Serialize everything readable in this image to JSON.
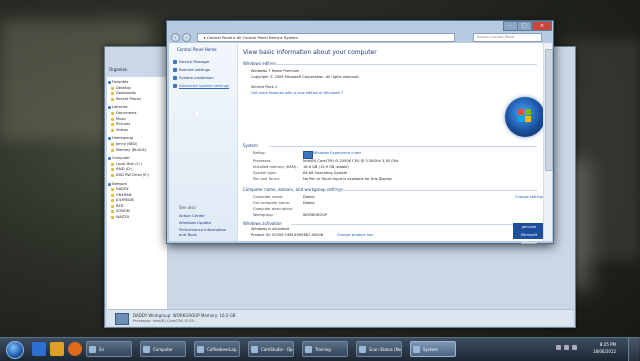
{
  "explorer": {
    "toolbar": "Organize",
    "nav": [
      {
        "label": "Favorites",
        "head": true
      },
      {
        "label": "Desktop"
      },
      {
        "label": "Downloads"
      },
      {
        "label": "Recent Places"
      },
      {
        "label": "Libraries",
        "head": true
      },
      {
        "label": "Documents"
      },
      {
        "label": "Music"
      },
      {
        "label": "Pictures"
      },
      {
        "label": "Videos"
      },
      {
        "label": "Homegroup",
        "head": true
      },
      {
        "label": "Jenny (BED)"
      },
      {
        "label": "Mommy (BLACK)"
      },
      {
        "label": "Computer",
        "head": true
      },
      {
        "label": "Local Disk (C:)"
      },
      {
        "label": "RAID (D:)"
      },
      {
        "label": "DVD RW Drive (E:)"
      },
      {
        "label": "Network",
        "head": true
      },
      {
        "label": "DADDY"
      },
      {
        "label": "GRAHAN"
      },
      {
        "label": "JULYREDIE"
      },
      {
        "label": "RED"
      },
      {
        "label": "SONOM"
      },
      {
        "label": "WAZZA"
      }
    ],
    "status_name": "DADDY  Workgroup: WORKGROUP   Memory: 16.0 GB",
    "status_cpu": "Processor: Intel(R) Core(TM) i5-25..."
  },
  "system": {
    "address": "▸ Control Panel ▸ All Control Panel Items ▸ System",
    "search_placeholder": "Search Control Panel",
    "left": {
      "home": "Control Panel Home",
      "links": [
        "Device Manager",
        "Remote settings",
        "System protection",
        "Advanced system settings"
      ],
      "see_also": "See also",
      "see_links": [
        "Action Center",
        "Windows Update",
        "Performance Information and Tools"
      ]
    },
    "main": {
      "title": "View basic information about your computer",
      "edition_header": "Windows edition",
      "edition": "Windows 7 Home Premium",
      "copyright": "Copyright © 2009 Microsoft Corporation. All rights reserved.",
      "service_pack": "Service Pack 1",
      "upgrade_link": "Get more features with a new edition of Windows 7",
      "system_header": "System",
      "rows": [
        {
          "label": "Rating:",
          "value": "Windows Experience Index"
        },
        {
          "label": "Processor:",
          "value": "Intel(R) Core(TM) i5-2500K CPU @ 3.30GHz   3.30 GHz"
        },
        {
          "label": "Installed memory (RAM):",
          "value": "16.0 GB (15.9 GB usable)"
        },
        {
          "label": "System type:",
          "value": "64-bit Operating System"
        },
        {
          "label": "Pen and Touch:",
          "value": "No Pen or Touch Input is available for this Display"
        }
      ],
      "name_header": "Computer name, domain, and workgroup settings",
      "name_rows": [
        {
          "label": "Computer name:",
          "value": "Daddy"
        },
        {
          "label": "Full computer name:",
          "value": "Daddy"
        },
        {
          "label": "Computer description:",
          "value": ""
        },
        {
          "label": "Workgroup:",
          "value": "WORKGROUP"
        }
      ],
      "change_settings": "Change settings",
      "activation_header": "Windows activation",
      "activated": "Windows is activated",
      "product_id": "Product ID: 00359-OEM-8992687-00006",
      "change_key": "Change product key",
      "genuine": "genuine Microsoft software"
    }
  },
  "taskbar": {
    "items": [
      {
        "label": "Sir",
        "active": false
      },
      {
        "label": "Computer",
        "active": false
      },
      {
        "label": "CoffeebeerLap...",
        "active": false
      },
      {
        "label": "CamStudio - Ope...",
        "active": false
      },
      {
        "label": "Training",
        "active": false
      },
      {
        "label": "Scan Status (Not R...",
        "active": false
      },
      {
        "label": "System",
        "active": true
      }
    ],
    "time": "8:25 PM",
    "date": "18/06/2012"
  },
  "colors": {
    "accent": "#1e3c7a",
    "link": "#1e5bb8",
    "taskbar": "#2a3746"
  }
}
